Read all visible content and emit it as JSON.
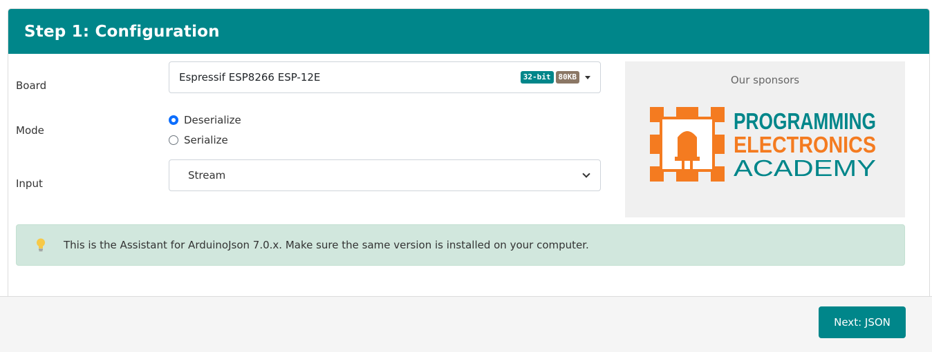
{
  "header": {
    "title": "Step 1: Configuration"
  },
  "form": {
    "board": {
      "label": "Board",
      "value": "Espressif ESP8266 ESP-12E",
      "badges": {
        "bits": "32-bit",
        "memory": "80KB"
      }
    },
    "mode": {
      "label": "Mode",
      "options": [
        {
          "label": "Deserialize",
          "checked": true
        },
        {
          "label": "Serialize",
          "checked": false
        }
      ]
    },
    "input": {
      "label": "Input",
      "value": "Stream"
    }
  },
  "sponsors": {
    "title": "Our sponsors",
    "logo_lines": [
      "PROGRAMMING",
      "ELECTRONICS",
      "ACADEMY"
    ]
  },
  "alert": {
    "icon": "lightbulb-icon",
    "text": "This is the Assistant for ArduinoJson 7.0.x. Make sure the same version is installed on your computer."
  },
  "footer": {
    "next_label": "Next: JSON"
  },
  "colors": {
    "primary": "#00868a",
    "badge_memory": "#8b7765",
    "alert_bg": "#d1e7dd",
    "logo_orange": "#f47b20",
    "logo_teal": "#00868a"
  }
}
